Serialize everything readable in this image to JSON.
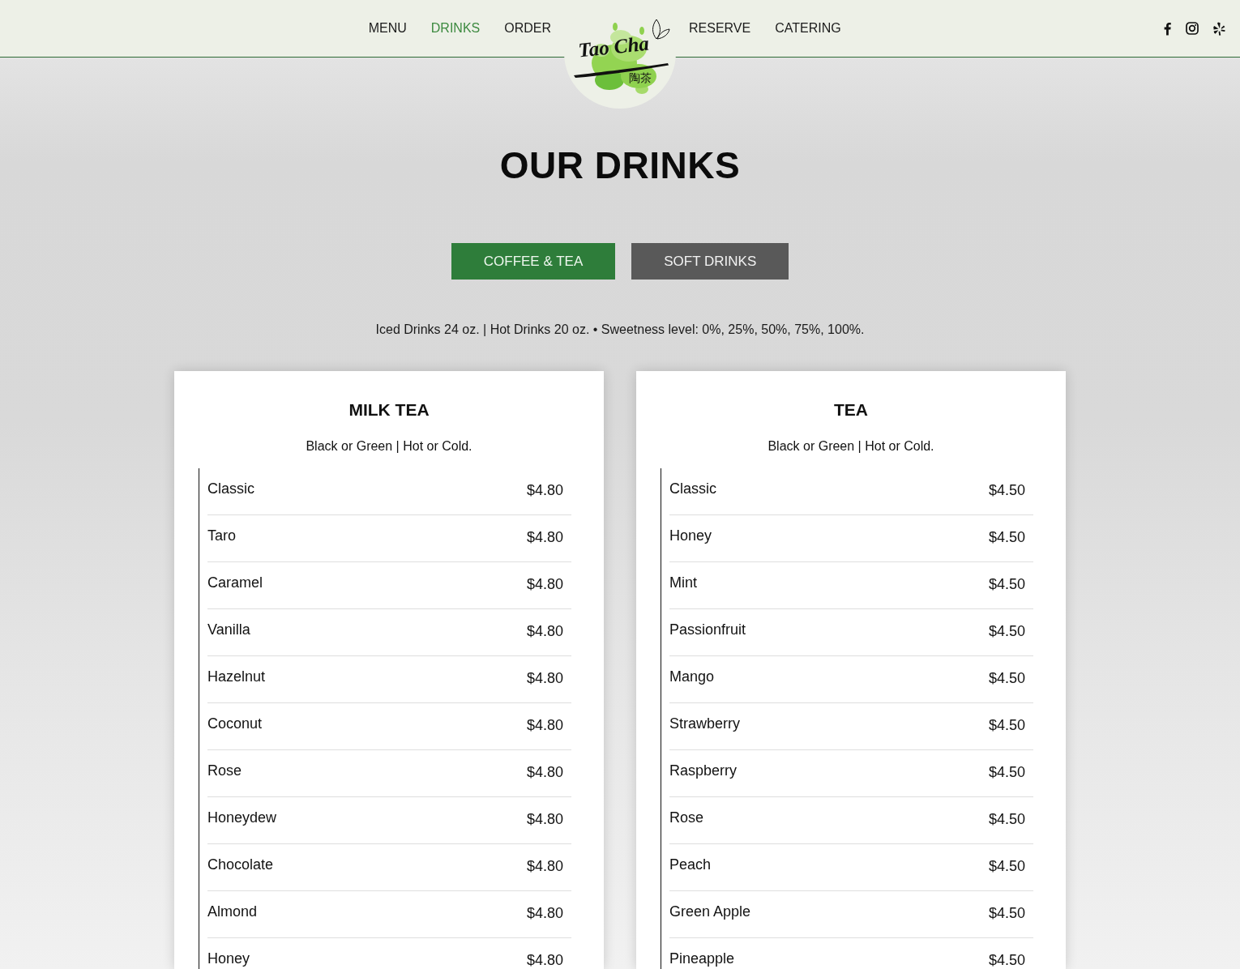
{
  "nav": {
    "left": [
      {
        "label": "MENU",
        "selected": false
      },
      {
        "label": "DRINKS",
        "selected": true
      },
      {
        "label": "ORDER",
        "selected": false
      }
    ],
    "logo": {
      "text": "Tao Cha",
      "subtext": "陶茶"
    },
    "right": [
      {
        "label": "RESERVE",
        "selected": false
      },
      {
        "label": "CATERING",
        "selected": false
      }
    ]
  },
  "heading": "OUR DRINKS",
  "tabs": [
    {
      "label": "COFFEE & TEA",
      "selected": true
    },
    {
      "label": "SOFT DRINKS",
      "selected": false
    }
  ],
  "note": "Iced Drinks 24 oz. | Hot Drinks 20 oz. • Sweetness level: 0%, 25%, 50%, 75%, 100%.",
  "menus": [
    {
      "title": "MILK TEA",
      "subtitle": "Black or Green | Hot or Cold.",
      "items": [
        {
          "name": "Classic",
          "price": "$4.80"
        },
        {
          "name": "Taro",
          "price": "$4.80"
        },
        {
          "name": "Caramel",
          "price": "$4.80"
        },
        {
          "name": "Vanilla",
          "price": "$4.80"
        },
        {
          "name": "Hazelnut",
          "price": "$4.80"
        },
        {
          "name": "Coconut",
          "price": "$4.80"
        },
        {
          "name": "Rose",
          "price": "$4.80"
        },
        {
          "name": "Honeydew",
          "price": "$4.80"
        },
        {
          "name": "Chocolate",
          "price": "$4.80"
        },
        {
          "name": "Almond",
          "price": "$4.80"
        },
        {
          "name": "Honey",
          "price": "$4.80"
        }
      ]
    },
    {
      "title": "TEA",
      "subtitle": "Black or Green | Hot or Cold.",
      "items": [
        {
          "name": "Classic",
          "price": "$4.50"
        },
        {
          "name": "Honey",
          "price": "$4.50"
        },
        {
          "name": "Mint",
          "price": "$4.50"
        },
        {
          "name": "Passionfruit",
          "price": "$4.50"
        },
        {
          "name": "Mango",
          "price": "$4.50"
        },
        {
          "name": "Strawberry",
          "price": "$4.50"
        },
        {
          "name": "Raspberry",
          "price": "$4.50"
        },
        {
          "name": "Rose",
          "price": "$4.50"
        },
        {
          "name": "Peach",
          "price": "$4.50"
        },
        {
          "name": "Green Apple",
          "price": "$4.50"
        },
        {
          "name": "Pineapple",
          "price": "$4.50"
        }
      ]
    }
  ]
}
